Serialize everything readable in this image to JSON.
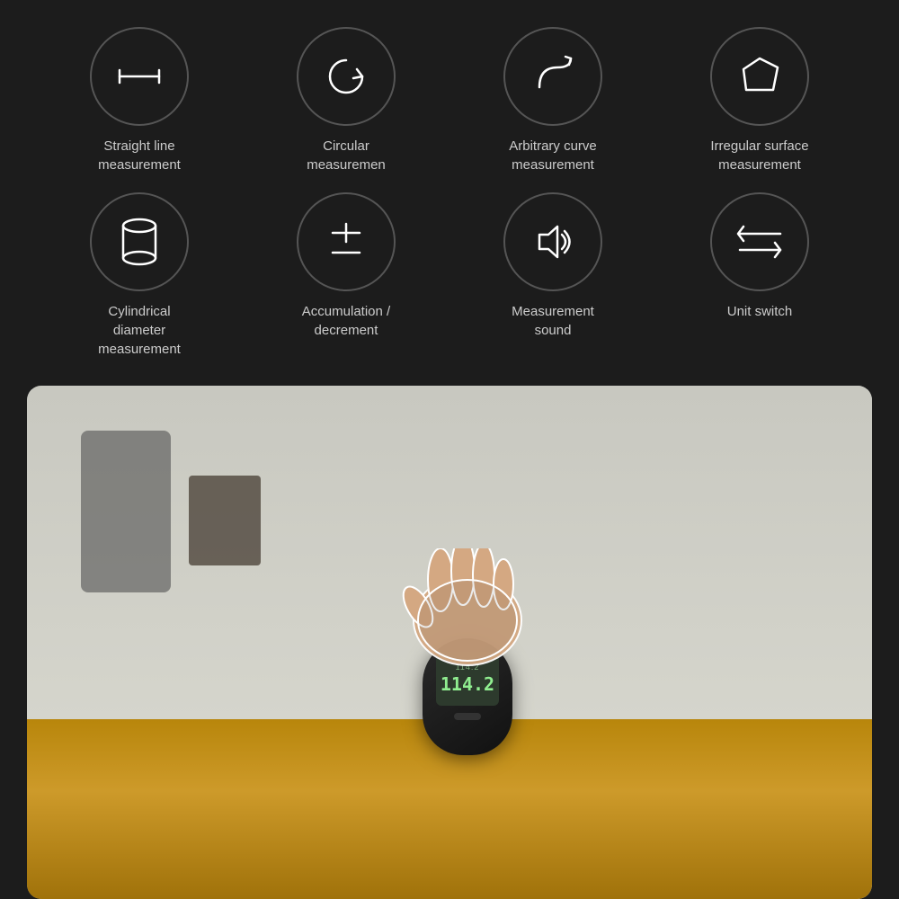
{
  "background_color": "#1c1c1c",
  "features_row1": [
    {
      "id": "straight-line",
      "label": "Straight line\nmeasurement",
      "icon": "ruler"
    },
    {
      "id": "circular",
      "label": "Circular\nmeasuremen",
      "icon": "circular-arrow"
    },
    {
      "id": "arbitrary-curve",
      "label": "Arbitrary curve\nmeasurement",
      "icon": "curve-arrow"
    },
    {
      "id": "irregular-surface",
      "label": "Irregular surface\nmeasurement",
      "icon": "polygon"
    }
  ],
  "features_row2": [
    {
      "id": "cylindrical",
      "label": "Cylindrical\ndiameter\nmeasurement",
      "icon": "cylinder"
    },
    {
      "id": "accumulation",
      "label": "Accumulation /\ndecrement",
      "icon": "plus-minus"
    },
    {
      "id": "measurement-sound",
      "label": "Measurement\nsound",
      "icon": "speaker"
    },
    {
      "id": "unit-switch",
      "label": "Unit switch",
      "icon": "arrows-left"
    }
  ],
  "device": {
    "screen_top": "114.2",
    "screen_main": "114.2"
  }
}
